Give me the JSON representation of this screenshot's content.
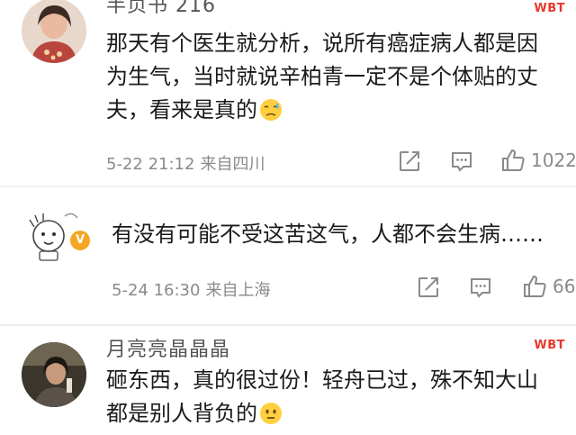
{
  "comments": [
    {
      "username": "半页书 216",
      "brand": "WBT",
      "text_lines": [
        "那天有个医生就分析，说所有癌症病人都是因",
        "为生气，当时就说辛柏青一定不是个体贴的丈",
        "夫，看来是真的"
      ],
      "emoji": "sad-sweat-emoji",
      "date": "5-22 21:12",
      "location": "来自四川",
      "like_count": "1022"
    },
    {
      "text_lines": [
        "有没有可能不受这苦这气，人都不会生病……"
      ],
      "badge": "V",
      "date": "5-24 16:30",
      "location": "来自上海",
      "like_count": "66"
    },
    {
      "username": "月亮亮晶晶晶",
      "brand": "WBT",
      "text_lines": [
        "砸东西，真的很过份！轻舟已过，殊不知大山",
        "都是别人背负的"
      ],
      "emoji": "awkward-smile-emoji"
    }
  ],
  "colors": {
    "text": "#1a1a1a",
    "meta": "#8a8a8a",
    "brand_red": "#e8382c",
    "badge_orange": "#f5a623",
    "divider": "#efefef"
  }
}
